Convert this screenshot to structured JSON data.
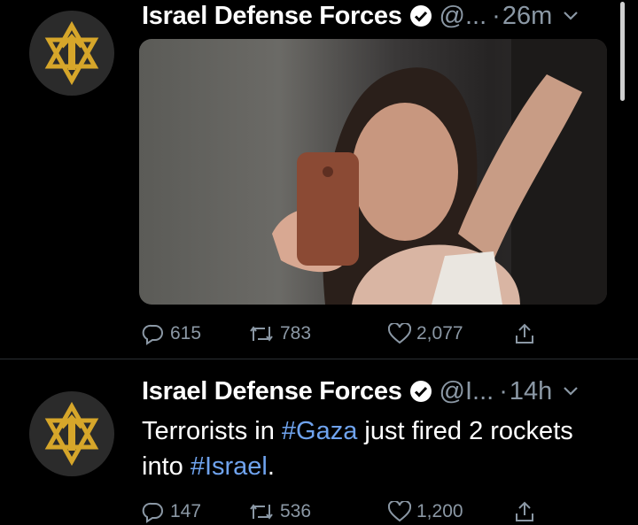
{
  "tweets": [
    {
      "author": "Israel Defense Forces",
      "handle": "@...",
      "time": "26m",
      "reply_count": "615",
      "retweet_count": "783",
      "like_count": "2,077"
    },
    {
      "author": "Israel Defense Forces",
      "handle": "@I...",
      "time": "14h",
      "text_part1": "Terrorists in ",
      "hashtag1": "#Gaza",
      "text_part2": " just fired 2 rockets into ",
      "hashtag2": "#Israel",
      "text_part3": ".",
      "reply_count": "147",
      "retweet_count": "536",
      "like_count": "1,200"
    }
  ],
  "separator": "·",
  "colors": {
    "background": "#000000",
    "secondary_text": "#8b98a5",
    "hashtag": "#6fa3ee",
    "avatar_emblem": "#d6a62a"
  }
}
